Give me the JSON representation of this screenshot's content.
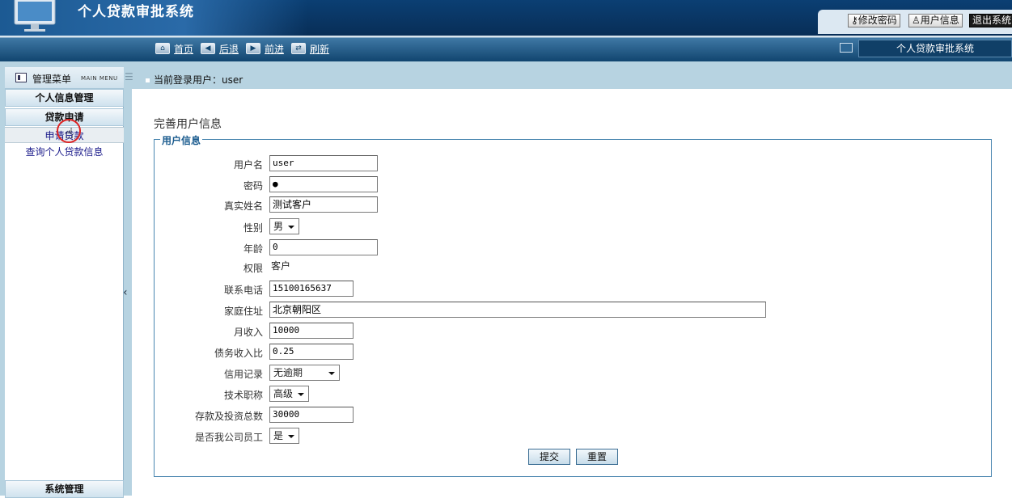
{
  "header": {
    "app_title": "个人贷款审批系统",
    "change_password": "修改密码",
    "user_info": "用户信息",
    "logout": "退出系统"
  },
  "toolbar": {
    "home": "首页",
    "back": "后退",
    "forward": "前进",
    "refresh": "刷新",
    "right_title": "个人贷款审批系统"
  },
  "sidebar": {
    "title": "管理菜单",
    "subtitle": "MAIN MENU",
    "groups": [
      {
        "label": "个人信息管理"
      },
      {
        "label": "贷款申请"
      },
      {
        "label": "系统管理"
      }
    ],
    "items": [
      {
        "label": "申请贷款"
      },
      {
        "label": "查询个人贷款信息"
      }
    ]
  },
  "login": {
    "text": "当前登录用户：user"
  },
  "page": {
    "title": "完善用户信息",
    "legend": "用户信息"
  },
  "form": {
    "username": {
      "label": "用户名",
      "value": "user"
    },
    "password": {
      "label": "密码",
      "value": "●"
    },
    "realname": {
      "label": "真实姓名",
      "value": "测试客户"
    },
    "gender": {
      "label": "性别",
      "value": "男"
    },
    "age": {
      "label": "年龄",
      "value": "0"
    },
    "role": {
      "label": "权限",
      "value": "客户"
    },
    "phone": {
      "label": "联系电话",
      "value": "15100165637"
    },
    "address": {
      "label": "家庭住址",
      "value": "北京朝阳区"
    },
    "income": {
      "label": "月收入",
      "value": "10000"
    },
    "debt_ratio": {
      "label": "债务收入比",
      "value": "0.25"
    },
    "credit": {
      "label": "信用记录",
      "value": "无逾期"
    },
    "title": {
      "label": "技术职称",
      "value": "高级"
    },
    "savings": {
      "label": "存款及投资总数",
      "value": "30000"
    },
    "employee": {
      "label": "是否我公司员工",
      "value": "是"
    },
    "submit": "提交",
    "reset": "重置"
  }
}
